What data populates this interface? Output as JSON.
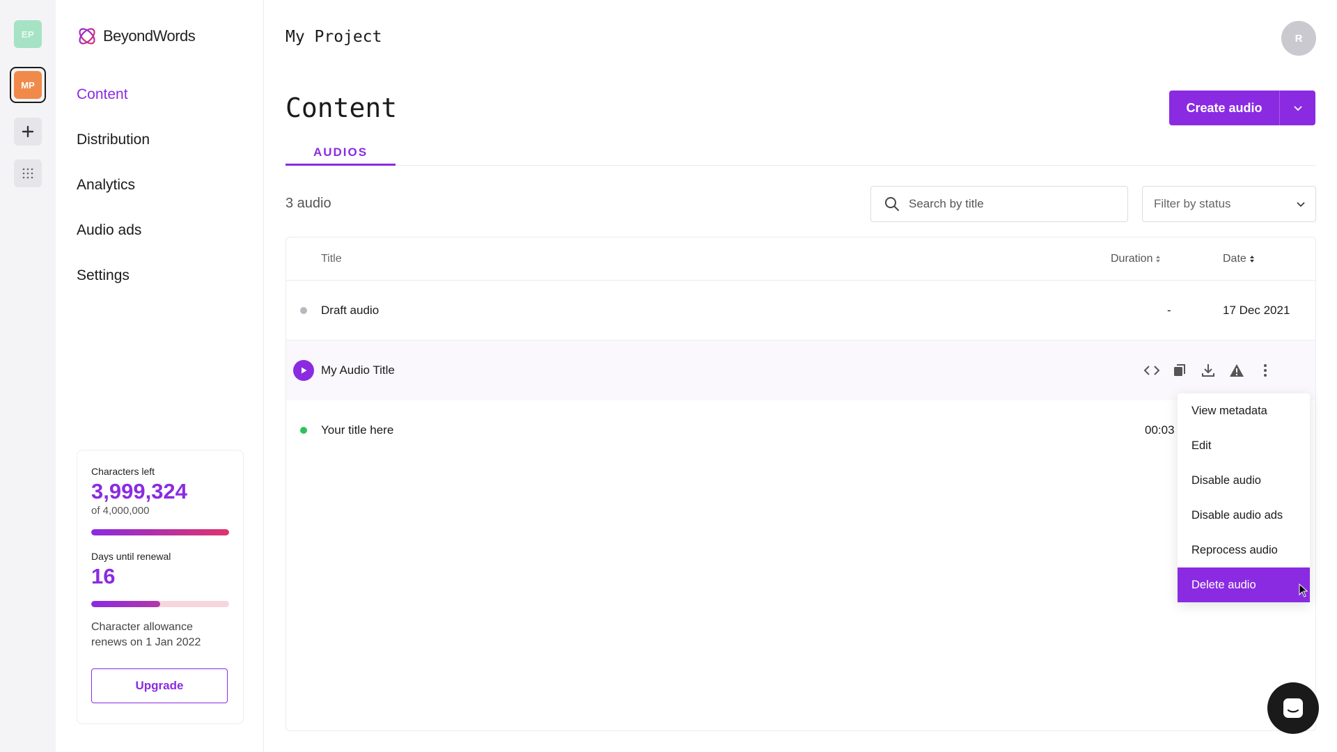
{
  "workspaces": [
    {
      "initials": "EP",
      "color": "#a6e3c4"
    },
    {
      "initials": "MP",
      "color": "#f08a4b",
      "active": true
    }
  ],
  "brand": {
    "name": "BeyondWords"
  },
  "nav": {
    "items": [
      {
        "label": "Content",
        "active": true
      },
      {
        "label": "Distribution"
      },
      {
        "label": "Analytics"
      },
      {
        "label": "Audio ads"
      },
      {
        "label": "Settings"
      }
    ]
  },
  "usage": {
    "characters_label": "Characters left",
    "characters_left": "3,999,324",
    "characters_total": "of 4,000,000",
    "characters_fraction": 0.9998,
    "days_label": "Days until renewal",
    "days": "16",
    "days_fraction": 0.5,
    "note": "Character allowance renews on 1 Jan 2022",
    "upgrade_label": "Upgrade"
  },
  "header": {
    "project": "My Project",
    "avatar_initial": "R"
  },
  "page": {
    "title": "Content",
    "create_label": "Create audio",
    "tab": "AUDIOS",
    "count": "3 audio",
    "search_placeholder": "Search by title",
    "filter_placeholder": "Filter by status"
  },
  "table": {
    "columns": {
      "title": "Title",
      "duration": "Duration",
      "date": "Date"
    },
    "rows": [
      {
        "title": "Draft audio",
        "duration": "-",
        "date": "17 Dec 2021",
        "status_color": "#b8b8c0"
      },
      {
        "title": "My Audio Title",
        "duration": "",
        "date": ""
      },
      {
        "title": "Your title here",
        "duration": "00:03",
        "date": "",
        "status_color": "#2ec25a"
      }
    ]
  },
  "menu": {
    "items": [
      "View metadata",
      "Edit",
      "Disable audio",
      "Disable audio ads",
      "Reprocess audio",
      "Delete audio"
    ]
  },
  "colors": {
    "accent": "#8a2be2"
  },
  "icons": [
    "code-icon",
    "copy-icon",
    "download-icon",
    "warning-icon",
    "more-vertical-icon",
    "search-icon",
    "chevron-down-icon",
    "play-icon",
    "plus-icon",
    "grid-icon",
    "chat-icon"
  ]
}
